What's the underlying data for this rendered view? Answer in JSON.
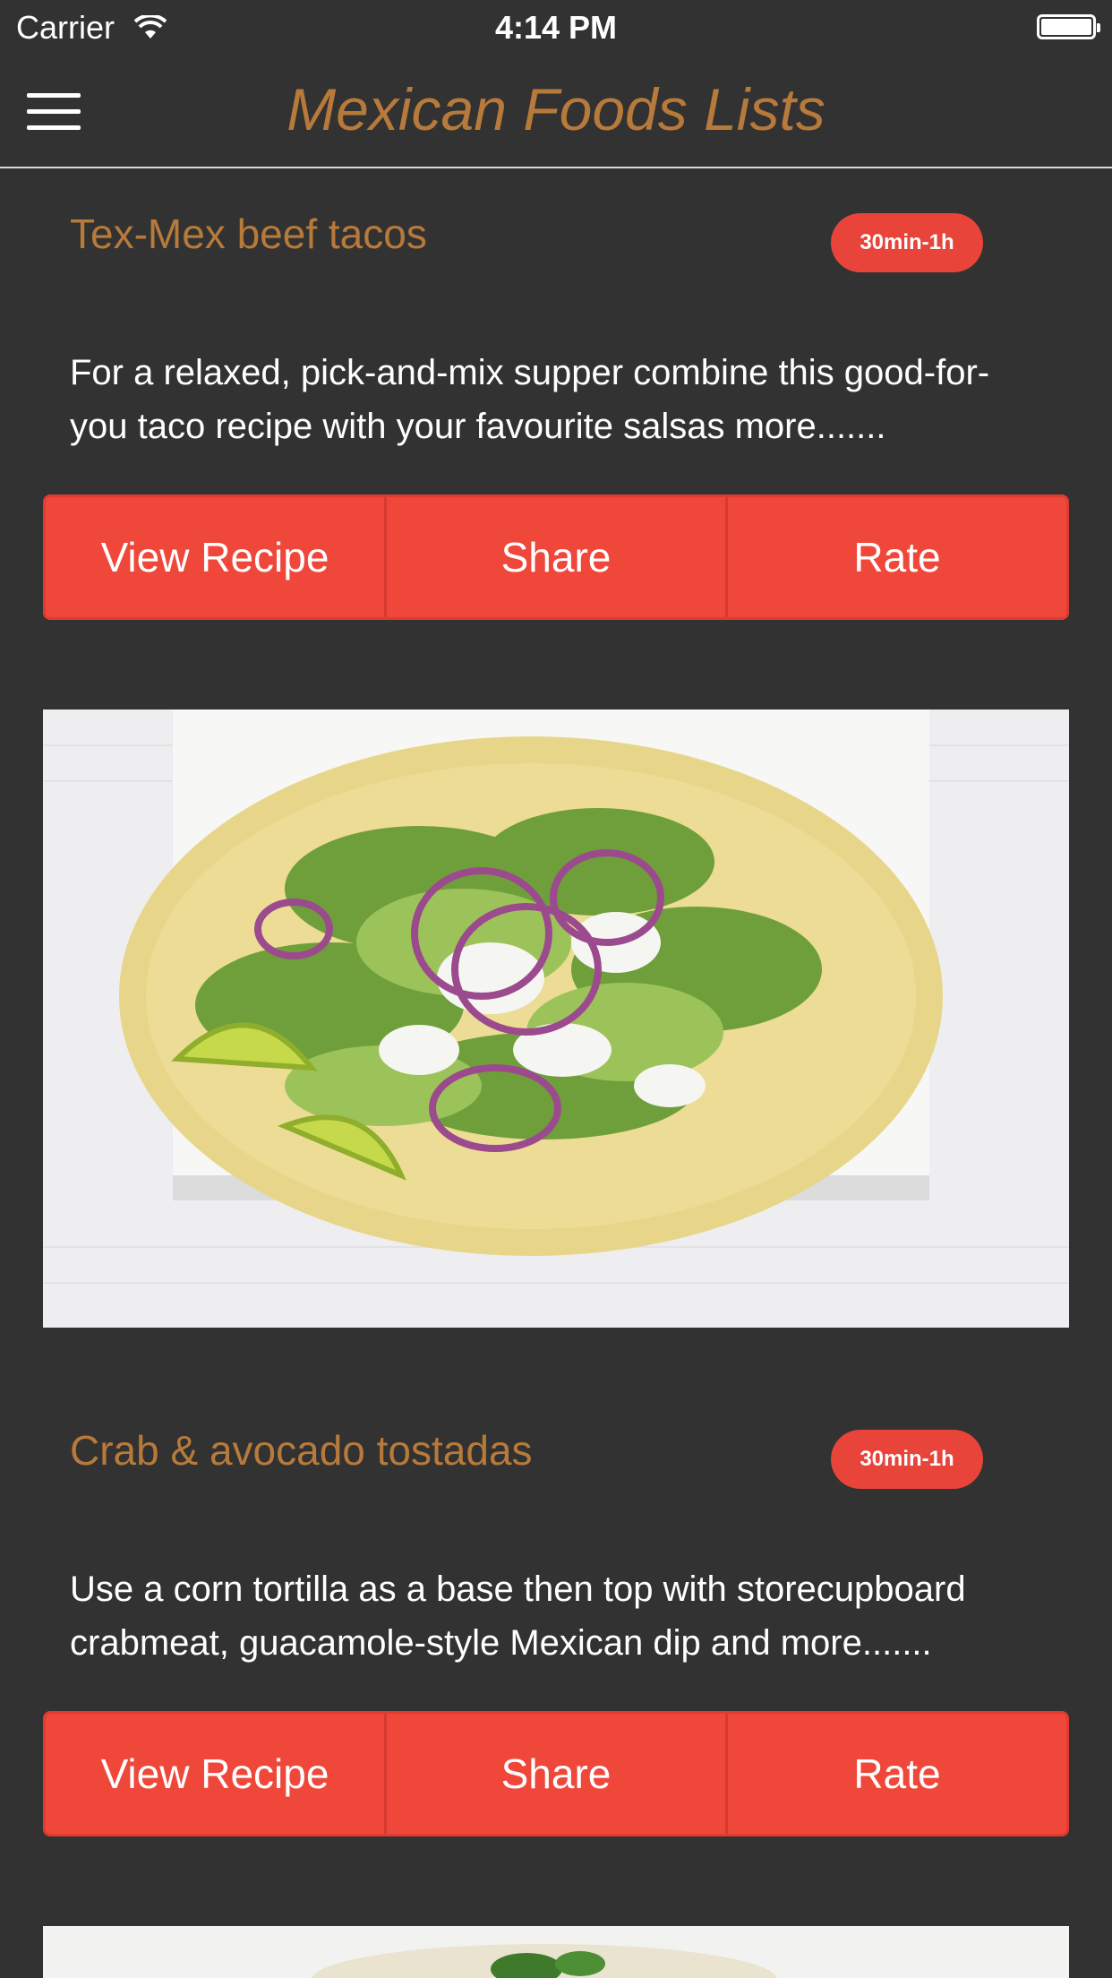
{
  "status_bar": {
    "carrier": "Carrier",
    "time": "4:14 PM"
  },
  "nav": {
    "title": "Mexican Foods Lists"
  },
  "recipes": [
    {
      "title": "Tex-Mex beef tacos",
      "time_badge": "30min-1h",
      "description": "For a relaxed, pick-and-mix supper combine this good-for-you taco recipe with your favourite salsas more.......",
      "buttons": [
        "View Recipe",
        "Share",
        "Rate"
      ]
    },
    {
      "title": "Crab & avocado tostadas",
      "time_badge": "30min-1h",
      "description": "Use a corn tortilla as a base then top with storecupboard crabmeat, guacamole-style Mexican dip and more.......",
      "buttons": [
        "View Recipe",
        "Share",
        "Rate"
      ]
    }
  ],
  "colors": {
    "background": "#323232",
    "accent_title": "#b77a3b",
    "button_red": "#f0473b",
    "badge_red": "#e8443a"
  }
}
